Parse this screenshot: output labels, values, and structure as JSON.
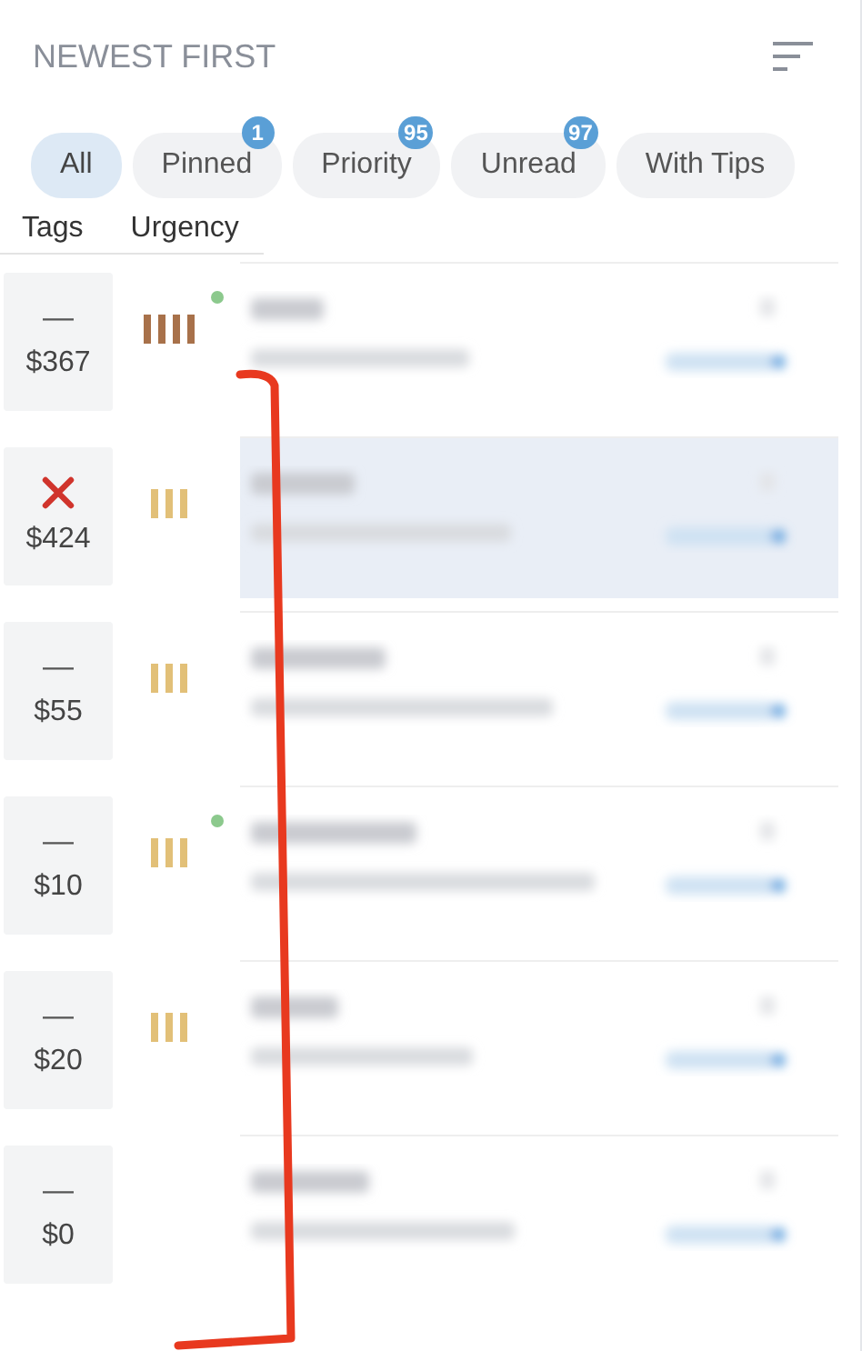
{
  "header": {
    "sort_label": "NEWEST FIRST"
  },
  "filters": [
    {
      "label": "All",
      "selected": true
    },
    {
      "label": "Pinned",
      "selected": false,
      "count": "1"
    },
    {
      "label": "Priority",
      "selected": false,
      "count": "95"
    },
    {
      "label": "Unread",
      "selected": false,
      "count": "97"
    },
    {
      "label": "With Tips",
      "selected": false
    }
  ],
  "columns": [
    "Tags",
    "Urgency"
  ],
  "rows": [
    {
      "tag": {
        "kind": "dash",
        "text": "—"
      },
      "amount": "$367",
      "urgency": {
        "kind": "high",
        "color": "#a8714a"
      },
      "online": true,
      "highlighted": false
    },
    {
      "tag": {
        "kind": "cross"
      },
      "amount": "$424",
      "urgency": {
        "kind": "medium",
        "color": "#e2c078"
      },
      "online": false,
      "highlighted": true
    },
    {
      "tag": {
        "kind": "dash",
        "text": "—"
      },
      "amount": "$55",
      "urgency": {
        "kind": "medium",
        "color": "#e2c078"
      },
      "online": false,
      "highlighted": false
    },
    {
      "tag": {
        "kind": "dash",
        "text": "—"
      },
      "amount": "$10",
      "urgency": {
        "kind": "medium",
        "color": "#e2c078"
      },
      "online": true,
      "highlighted": false
    },
    {
      "tag": {
        "kind": "dash",
        "text": "—"
      },
      "amount": "$20",
      "urgency": {
        "kind": "medium",
        "color": "#e2c078"
      },
      "online": false,
      "highlighted": false
    },
    {
      "tag": {
        "kind": "dash",
        "text": "—"
      },
      "amount": "$0",
      "online": false,
      "highlighted": false
    }
  ],
  "annotation": {
    "kind": "bracket-line"
  }
}
